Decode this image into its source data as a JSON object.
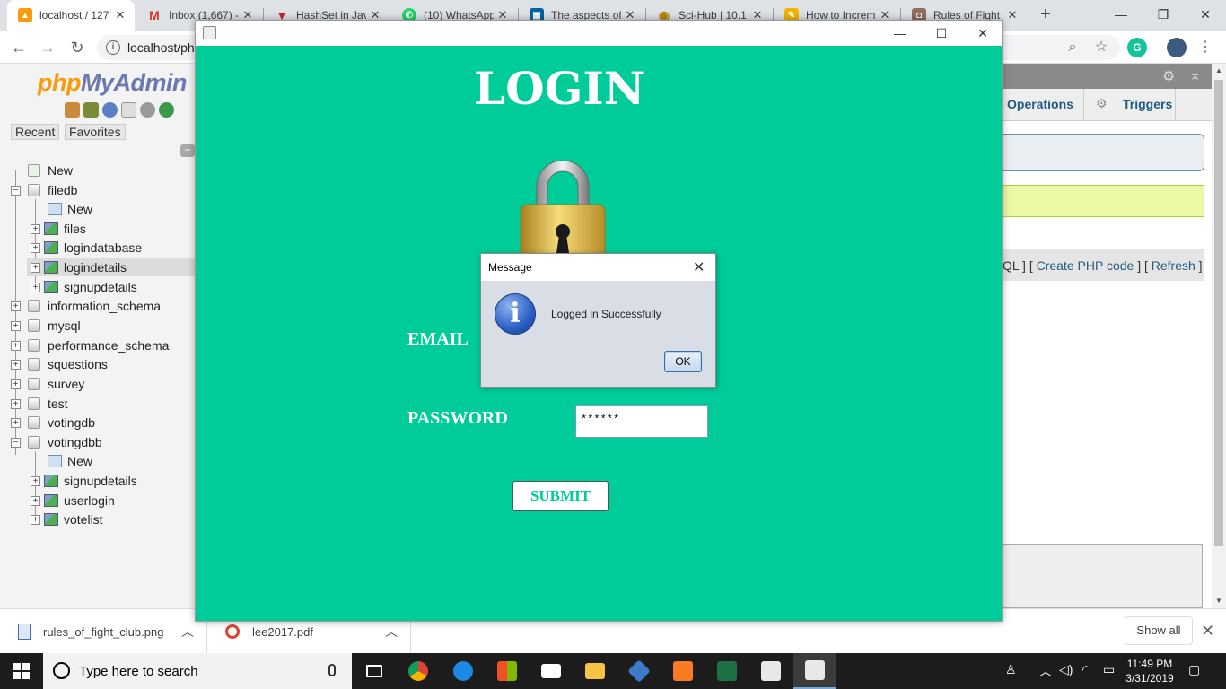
{
  "browser": {
    "tabs": [
      {
        "title": "localhost / 127",
        "icon": "phpmyadmin-icon",
        "color": "#f89c0e"
      },
      {
        "title": "Inbox (1,667) -",
        "icon": "gmail-icon",
        "color": "#d93025"
      },
      {
        "title": "HashSet in Jav",
        "icon": "geeks-icon",
        "color": "#c62828"
      },
      {
        "title": "(10) WhatsApp",
        "icon": "whatsapp-icon",
        "color": "#25d366"
      },
      {
        "title": "The aspects of",
        "icon": "ieee-icon",
        "color": "#00629b"
      },
      {
        "title": "Sci-Hub | 10.1",
        "icon": "scihub-icon",
        "color": "#b8860b"
      },
      {
        "title": "How to Increm",
        "icon": "page-icon",
        "color": "#f4b400"
      },
      {
        "title": "Rules of Fight",
        "icon": "fightclub-icon",
        "color": "#8d6e63"
      }
    ],
    "url": "localhost/ph"
  },
  "pma": {
    "logo_a": "php",
    "logo_b": "MyAdmin",
    "recent_label": "Recent",
    "favorites_label": "Favorites",
    "tree": {
      "new_top": "New",
      "filedb": "filedb",
      "filedb_new": "New",
      "files": "files",
      "logindatabase": "logindatabase",
      "logindetails": "logindetails",
      "signupdetails": "signupdetails",
      "information_schema": "information_schema",
      "mysql": "mysql",
      "performance_schema": "performance_schema",
      "squestions": "squestions",
      "survey": "survey",
      "test": "test",
      "votingdb": "votingdb",
      "votingdbb": "votingdbb",
      "votingdbb_new": "New",
      "votingdbb_signupdetails": "signupdetails",
      "userlogin": "userlogin",
      "votelist": "votelist"
    },
    "tabs": {
      "operations": "Operations",
      "triggers": "Triggers"
    },
    "links": {
      "prefix": "QL ] [ ",
      "create_php": "Create PHP code",
      "mid": " ] [ ",
      "refresh": "Refresh",
      "suffix": " ]"
    }
  },
  "java_window": {
    "title_label": "LOGIN",
    "email_label": "EMAIL",
    "password_label": "PASSWORD",
    "password_value": "******",
    "submit_label": "SUBMIT"
  },
  "dialog": {
    "title": "Message",
    "message": "Logged in Successfully",
    "ok_label": "OK"
  },
  "downloads": {
    "item1": "rules_of_fight_club.png",
    "item2": "lee2017.pdf",
    "show_all": "Show all"
  },
  "taskbar": {
    "search_placeholder": "Type here to search",
    "time": "11:49 PM",
    "date": "3/31/2019"
  },
  "colors": {
    "java_bg": "#00cc99",
    "pma_link": "#235a81"
  }
}
